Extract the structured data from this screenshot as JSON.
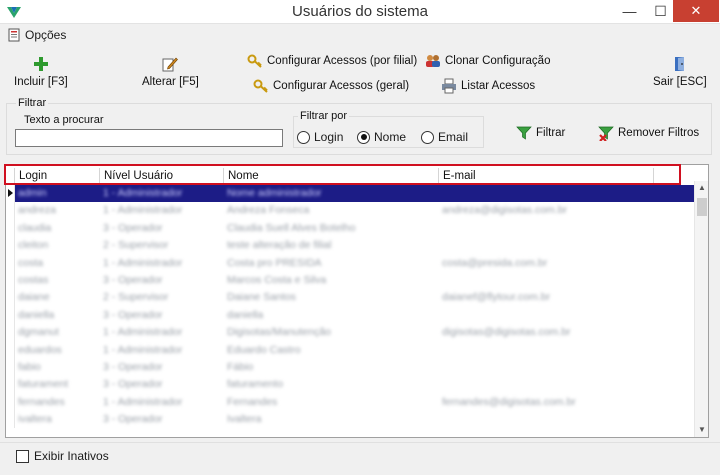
{
  "window": {
    "title": "Usuários do sistema",
    "controls": {
      "minimize": "—",
      "maximize": "☐",
      "close": "✕"
    }
  },
  "menu": {
    "options_label": "Opções"
  },
  "toolbar": {
    "include_label": "Incluir [F3]",
    "alter_label": "Alterar [F5]",
    "config_branch_label": "Configurar Acessos (por filial)",
    "config_general_label": "Configurar Acessos (geral)",
    "clone_label": "Clonar Configuração",
    "list_label": "Listar Acessos",
    "exit_label": "Sair [ESC]"
  },
  "filter": {
    "group_label": "Filtrar",
    "search_label": "Texto a procurar",
    "search_value": "",
    "filter_by_label": "Filtrar por",
    "options": [
      "Login",
      "Nome",
      "Email"
    ],
    "selected": "Nome",
    "filter_button": "Filtrar",
    "remove_button": "Remover Filtros"
  },
  "grid": {
    "columns": [
      "Login",
      "Nível Usuário",
      "Nome",
      "E-mail"
    ],
    "rows": [
      [
        "admin",
        "1 - Administrador",
        "Nome administrador",
        ""
      ],
      [
        "andreza",
        "1 - Administrador",
        "Andreza Fonseca",
        "andreza@digisotas.com.br"
      ],
      [
        "claudia",
        "3 - Operador",
        "Claudia Suell Alves Botelho",
        ""
      ],
      [
        "cleiton",
        "2 - Supervisor",
        "teste alteração de filial",
        ""
      ],
      [
        "costa",
        "1 - Administrador",
        "Costa pro PRESIDA",
        "costa@presida.com.br"
      ],
      [
        "costas",
        "3 - Operador",
        "Marcos Costa e Silva",
        ""
      ],
      [
        "daiane",
        "2 - Supervisor",
        "Daiane Santos",
        "daianef@flytour.com.br"
      ],
      [
        "daniella",
        "3 - Operador",
        "daniella",
        ""
      ],
      [
        "dgmanut",
        "1 - Administrador",
        "Digisotas/Manutenção",
        "digisotas@digisotas.com.br"
      ],
      [
        "eduardos",
        "1 - Administrador",
        "Eduardo Castro",
        ""
      ],
      [
        "fabio",
        "3 - Operador",
        "Fábio",
        ""
      ],
      [
        "faturament",
        "3 - Operador",
        "faturamento",
        ""
      ],
      [
        "fernandes",
        "1 - Administrador",
        "Fernandes",
        "fernandes@digisotas.com.br"
      ],
      [
        "ivaltera",
        "3 - Operador",
        "Ivaltera",
        ""
      ]
    ]
  },
  "footer": {
    "show_inactive_label": "Exibir Inativos",
    "show_inactive_checked": false
  },
  "colors": {
    "selection": "#1c1c86",
    "highlight_border": "#d01020",
    "close_button": "#c84031"
  }
}
